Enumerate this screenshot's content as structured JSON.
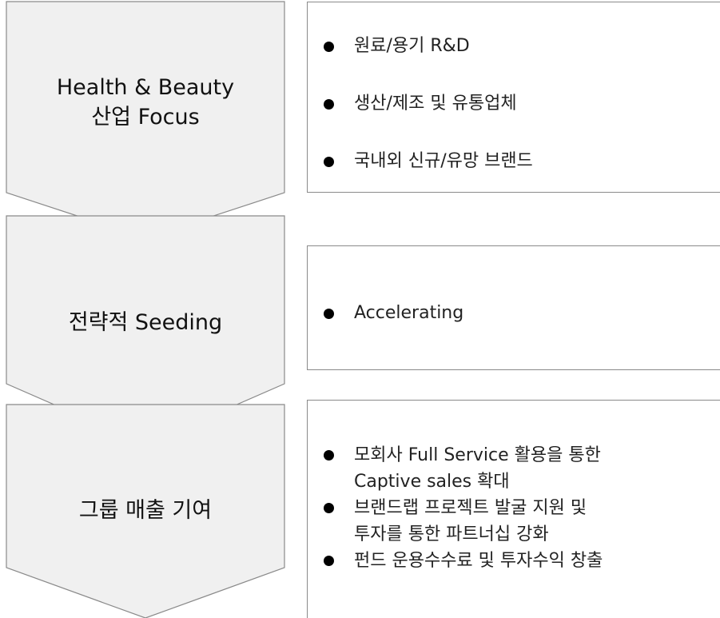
{
  "colors": {
    "chevron_fill": "#f0f0f0",
    "chevron_stroke": "#8a8a8a",
    "panel_border": "#8a8a8a",
    "bullet": "#000000"
  },
  "stages": [
    {
      "label": "Health & Beauty\n산업 Focus",
      "bullets": [
        "원료/용기 R&D",
        "생산/제조 및 유통업체",
        "국내외 신규/유망 브랜드"
      ]
    },
    {
      "label": "전략적 Seeding",
      "bullets": [
        "Accelerating"
      ]
    },
    {
      "label": "그룹 매출 기여",
      "bullets": [
        "모회사 Full Service 활용을 통한\nCaptive sales 확대",
        "브랜드랩 프로젝트 발굴 지원 및\n투자를 통한 파트너십 강화",
        "펀드 운용수수료 및 투자수익 창출"
      ]
    }
  ]
}
